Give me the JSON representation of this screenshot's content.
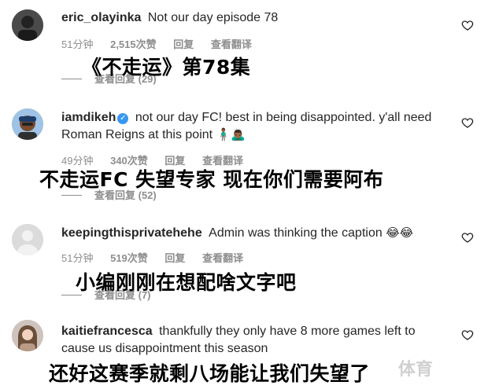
{
  "comments": [
    {
      "username": "eric_olayinka",
      "verified": false,
      "text": "Not our day episode 78",
      "time": "51分钟",
      "likes": "2,515次赞",
      "reply": "回复",
      "translate": "查看翻译",
      "view_replies": "查看回复 (29)",
      "subtitle": "《不走运》第78集"
    },
    {
      "username": "iamdikeh",
      "verified": true,
      "text": "not our day FC! best in being disappointed. y'all need Roman Reigns at this point",
      "emoji": "🧍🏾‍♂️🙇🏾‍♂️",
      "time": "49分钟",
      "likes": "340次赞",
      "reply": "回复",
      "translate": "查看翻译",
      "view_replies": "查看回复 (52)",
      "subtitle": "不走运FC 失望专家 现在你们需要阿布"
    },
    {
      "username": "keepingthisprivatehehe",
      "verified": false,
      "text": "Admin was thinking the caption",
      "emoji": "😂😂",
      "time": "51分钟",
      "likes": "519次赞",
      "reply": "回复",
      "translate": "查看翻译",
      "view_replies": "查看回复 (7)",
      "subtitle": "小编刚刚在想配啥文字吧"
    },
    {
      "username": "kaitiefrancesca",
      "verified": false,
      "text": "thankfully they only have 8 more games left to cause us disappointment this season",
      "subtitle": "还好这赛季就剩八场能让我们失望了"
    }
  ],
  "watermark": "体育",
  "colors": {
    "text": "#262626",
    "meta": "#8e8e8e",
    "verified": "#3897f0"
  },
  "icons": {
    "like": "heart-outline-icon",
    "verified": "verified-badge-icon"
  }
}
